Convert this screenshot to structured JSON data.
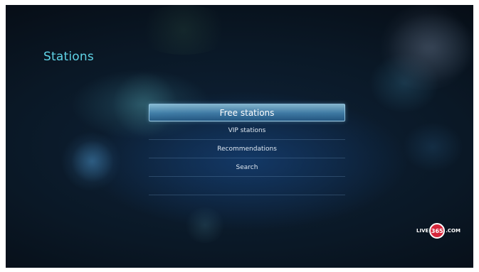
{
  "page": {
    "title": "Stations"
  },
  "menu": {
    "items": [
      {
        "label": "Free stations",
        "selected": true
      },
      {
        "label": "VIP stations",
        "selected": false
      },
      {
        "label": "Recommendations",
        "selected": false
      },
      {
        "label": "Search",
        "selected": false
      },
      {
        "label": "",
        "selected": false
      }
    ]
  },
  "brand": {
    "logo_prefix": "LIVE",
    "logo_number": "365",
    "logo_suffix": ".COM",
    "accent_color": "#d6263b"
  },
  "colors": {
    "title": "#5fd3e6",
    "highlight": "#4f8fbe"
  }
}
